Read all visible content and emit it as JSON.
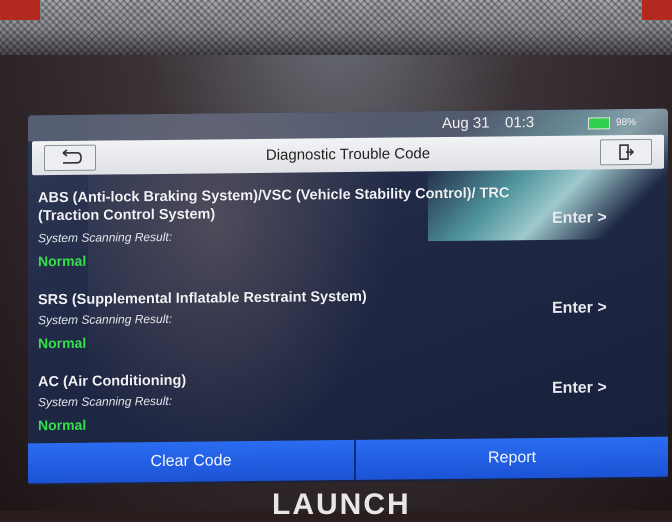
{
  "status_bar": {
    "date": "Aug 31",
    "time": "01:3",
    "battery": "98%"
  },
  "header": {
    "title": "Diagnostic Trouble Code",
    "back_icon": "back-arrow-icon",
    "exit_icon": "exit-icon"
  },
  "systems": [
    {
      "name": "ABS (Anti-lock Braking System)/VSC (Vehicle Stability Control)/ TRC (Traction Control System)",
      "scan_label": "System Scanning Result:",
      "result": "Normal",
      "enter_label": "Enter >"
    },
    {
      "name": "SRS (Supplemental Inflatable Restraint System)",
      "scan_label": "System Scanning Result:",
      "result": "Normal",
      "enter_label": "Enter >"
    },
    {
      "name": "AC (Air Conditioning)",
      "scan_label": "System Scanning Result:",
      "result": "Normal",
      "enter_label": "Enter >"
    }
  ],
  "actions": {
    "clear_code": "Clear Code",
    "report": "Report"
  },
  "device": {
    "brand": "LAUNCH"
  },
  "colors": {
    "accent": "#1f5ee0",
    "normal": "#35e04a",
    "device_red": "#b3291f"
  }
}
